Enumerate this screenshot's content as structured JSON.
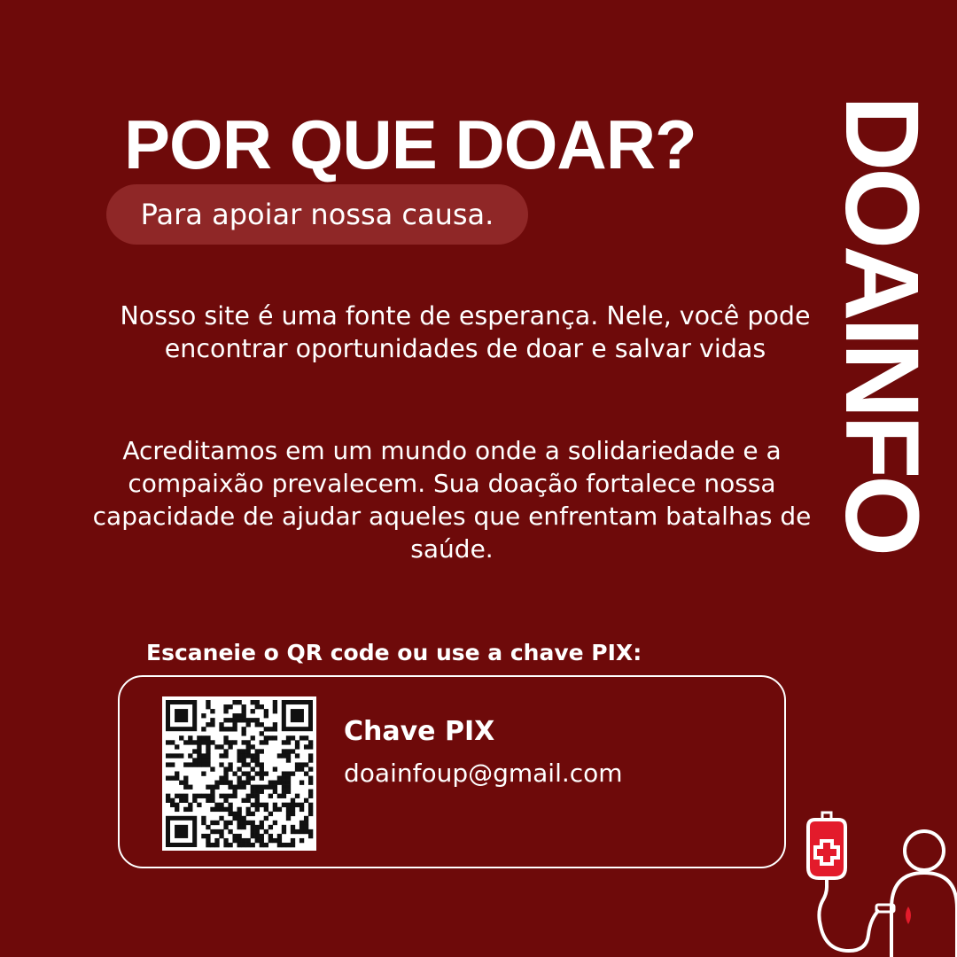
{
  "title": "POR QUE DOAR?",
  "subtitle": "Para apoiar nossa causa.",
  "paragraph1": "Nosso site é uma fonte de esperança. Nele, você pode encontrar oportunidades de doar e salvar vidas",
  "paragraph2": "Acreditamos em um mundo onde a solidariedade e a compaixão prevalecem. Sua doação fortalece nossa capacidade de ajudar aqueles que enfrentam batalhas de saúde.",
  "instruction": "Escaneie o QR code ou use a chave PIX:",
  "pix": {
    "title": "Chave PIX",
    "email": "doainfoup@gmail.com"
  },
  "brand": "DOAINFO",
  "colors": {
    "background": "#6e0a0a",
    "pill": "#8f2727",
    "accent": "#e31b2b"
  },
  "icons": [
    "qr-code-icon",
    "blood-bag-icon",
    "person-donor-icon"
  ]
}
